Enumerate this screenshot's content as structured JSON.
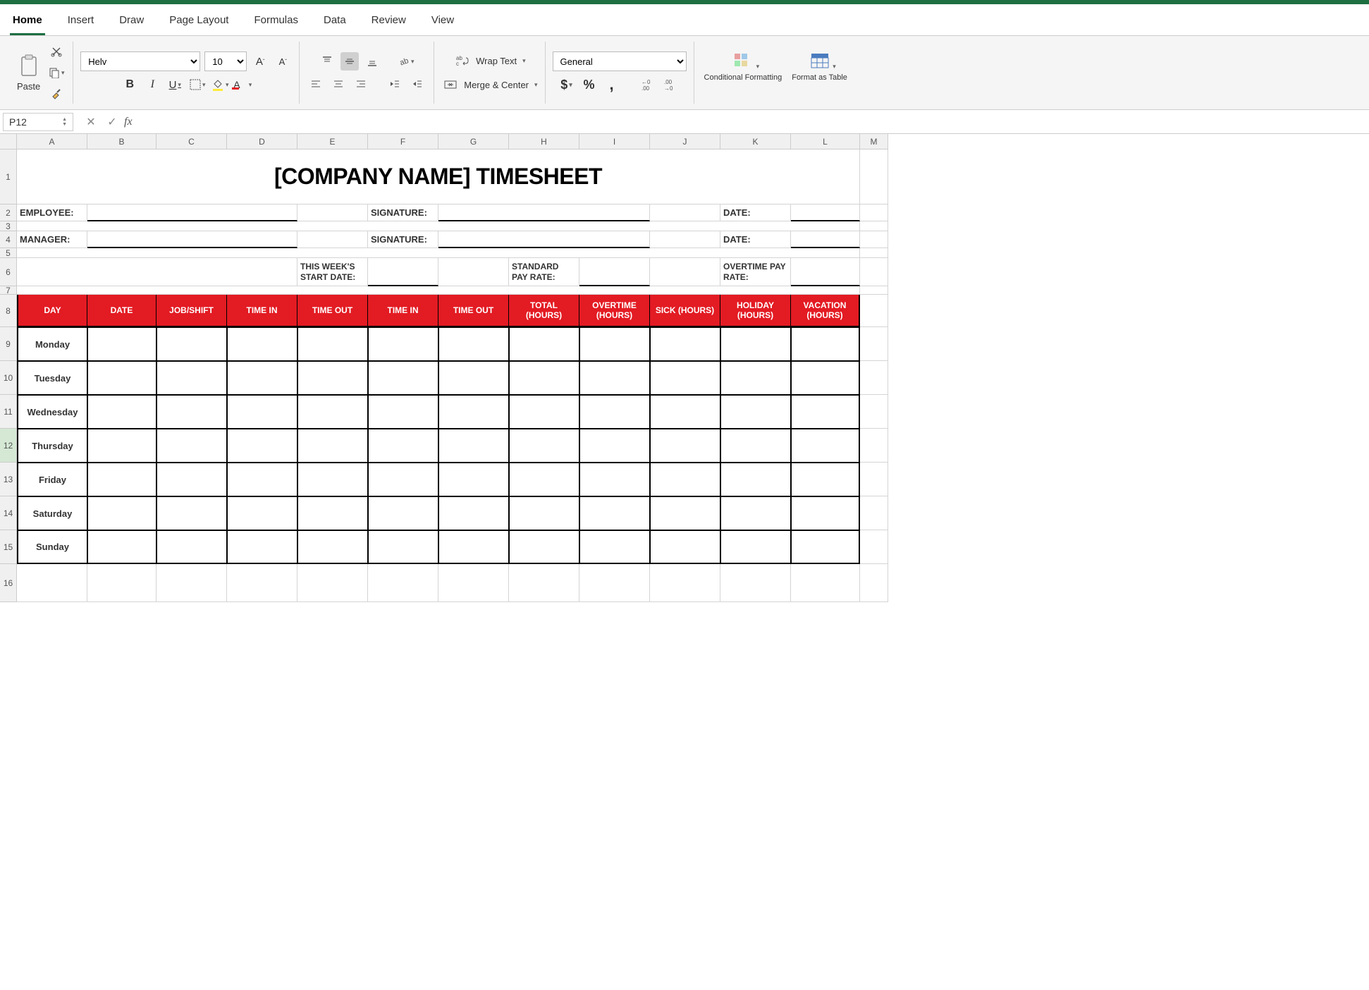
{
  "tabs": [
    "Home",
    "Insert",
    "Draw",
    "Page Layout",
    "Formulas",
    "Data",
    "Review",
    "View"
  ],
  "activeTab": "Home",
  "ribbon": {
    "paste": "Paste",
    "fontName": "Helv",
    "fontSize": "10",
    "wrapText": "Wrap Text",
    "mergeCenter": "Merge & Center",
    "numberFormat": "General",
    "conditionalFormatting": "Conditional Formatting",
    "formatAsTable": "Format as Table"
  },
  "formulaBar": {
    "nameBox": "P12",
    "formula": ""
  },
  "columns": [
    "A",
    "B",
    "C",
    "D",
    "E",
    "F",
    "G",
    "H",
    "I",
    "J",
    "K",
    "L",
    "M"
  ],
  "rows": [
    "1",
    "2",
    "3",
    "4",
    "5",
    "6",
    "7",
    "8",
    "9",
    "10",
    "11",
    "12",
    "13",
    "14",
    "15",
    "16"
  ],
  "sheet": {
    "title": "[COMPANY NAME] TIMESHEET",
    "employee": "EMPLOYEE:",
    "manager": "MANAGER:",
    "signature": "SIGNATURE:",
    "date": "DATE:",
    "weekStartDate": "THIS WEEK'S START DATE:",
    "standardPayRate": "STANDARD PAY RATE:",
    "overtimePayRate": "OVERTIME PAY RATE:",
    "headers": [
      "DAY",
      "DATE",
      "JOB/SHIFT",
      "TIME IN",
      "TIME OUT",
      "TIME IN",
      "TIME OUT",
      "TOTAL (HOURS)",
      "OVERTIME (HOURS)",
      "SICK (HOURS)",
      "HOLIDAY (HOURS)",
      "VACATION (HOURS)"
    ],
    "days": [
      "Monday",
      "Tuesday",
      "Wednesday",
      "Thursday",
      "Friday",
      "Saturday",
      "Sunday"
    ]
  }
}
